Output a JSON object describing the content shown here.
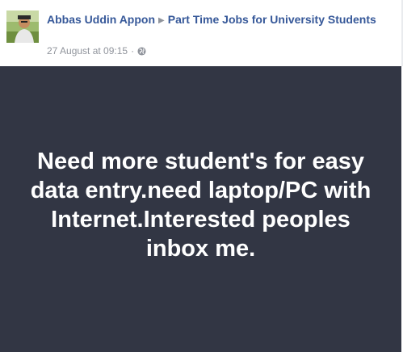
{
  "post": {
    "author": "Abbas Uddin Appon",
    "group": "Part Time Jobs for University Students",
    "timestamp": "27 August at 09:15",
    "separator": "·",
    "privacy_icon": "globe-icon",
    "body_text": "Need more student's for easy data entry.need laptop/PC with Internet.Interested peoples inbox me."
  },
  "colors": {
    "link": "#365899",
    "meta": "#90949c",
    "story_background": "#323644",
    "story_text": "#ffffff"
  }
}
